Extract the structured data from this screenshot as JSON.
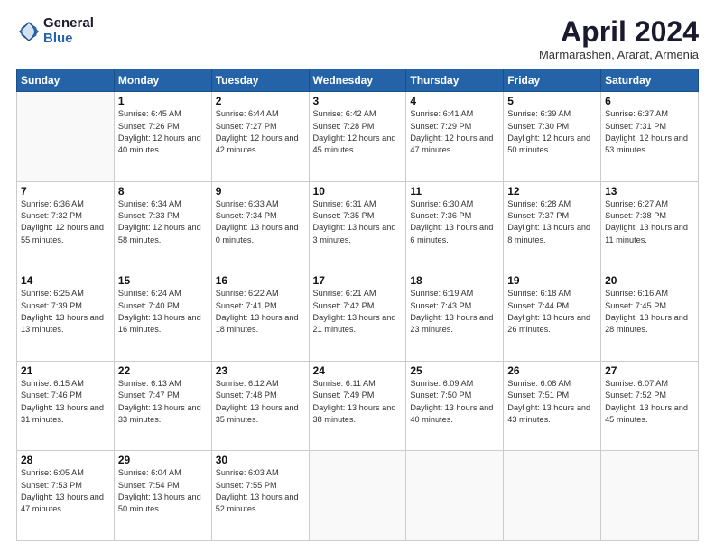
{
  "logo": {
    "general": "General",
    "blue": "Blue"
  },
  "header": {
    "title": "April 2024",
    "subtitle": "Marmarashen, Ararat, Armenia"
  },
  "weekdays": [
    "Sunday",
    "Monday",
    "Tuesday",
    "Wednesday",
    "Thursday",
    "Friday",
    "Saturday"
  ],
  "days": [
    {
      "num": "",
      "sunrise": "",
      "sunset": "",
      "daylight": ""
    },
    {
      "num": "1",
      "sunrise": "Sunrise: 6:45 AM",
      "sunset": "Sunset: 7:26 PM",
      "daylight": "Daylight: 12 hours and 40 minutes."
    },
    {
      "num": "2",
      "sunrise": "Sunrise: 6:44 AM",
      "sunset": "Sunset: 7:27 PM",
      "daylight": "Daylight: 12 hours and 42 minutes."
    },
    {
      "num": "3",
      "sunrise": "Sunrise: 6:42 AM",
      "sunset": "Sunset: 7:28 PM",
      "daylight": "Daylight: 12 hours and 45 minutes."
    },
    {
      "num": "4",
      "sunrise": "Sunrise: 6:41 AM",
      "sunset": "Sunset: 7:29 PM",
      "daylight": "Daylight: 12 hours and 47 minutes."
    },
    {
      "num": "5",
      "sunrise": "Sunrise: 6:39 AM",
      "sunset": "Sunset: 7:30 PM",
      "daylight": "Daylight: 12 hours and 50 minutes."
    },
    {
      "num": "6",
      "sunrise": "Sunrise: 6:37 AM",
      "sunset": "Sunset: 7:31 PM",
      "daylight": "Daylight: 12 hours and 53 minutes."
    },
    {
      "num": "7",
      "sunrise": "Sunrise: 6:36 AM",
      "sunset": "Sunset: 7:32 PM",
      "daylight": "Daylight: 12 hours and 55 minutes."
    },
    {
      "num": "8",
      "sunrise": "Sunrise: 6:34 AM",
      "sunset": "Sunset: 7:33 PM",
      "daylight": "Daylight: 12 hours and 58 minutes."
    },
    {
      "num": "9",
      "sunrise": "Sunrise: 6:33 AM",
      "sunset": "Sunset: 7:34 PM",
      "daylight": "Daylight: 13 hours and 0 minutes."
    },
    {
      "num": "10",
      "sunrise": "Sunrise: 6:31 AM",
      "sunset": "Sunset: 7:35 PM",
      "daylight": "Daylight: 13 hours and 3 minutes."
    },
    {
      "num": "11",
      "sunrise": "Sunrise: 6:30 AM",
      "sunset": "Sunset: 7:36 PM",
      "daylight": "Daylight: 13 hours and 6 minutes."
    },
    {
      "num": "12",
      "sunrise": "Sunrise: 6:28 AM",
      "sunset": "Sunset: 7:37 PM",
      "daylight": "Daylight: 13 hours and 8 minutes."
    },
    {
      "num": "13",
      "sunrise": "Sunrise: 6:27 AM",
      "sunset": "Sunset: 7:38 PM",
      "daylight": "Daylight: 13 hours and 11 minutes."
    },
    {
      "num": "14",
      "sunrise": "Sunrise: 6:25 AM",
      "sunset": "Sunset: 7:39 PM",
      "daylight": "Daylight: 13 hours and 13 minutes."
    },
    {
      "num": "15",
      "sunrise": "Sunrise: 6:24 AM",
      "sunset": "Sunset: 7:40 PM",
      "daylight": "Daylight: 13 hours and 16 minutes."
    },
    {
      "num": "16",
      "sunrise": "Sunrise: 6:22 AM",
      "sunset": "Sunset: 7:41 PM",
      "daylight": "Daylight: 13 hours and 18 minutes."
    },
    {
      "num": "17",
      "sunrise": "Sunrise: 6:21 AM",
      "sunset": "Sunset: 7:42 PM",
      "daylight": "Daylight: 13 hours and 21 minutes."
    },
    {
      "num": "18",
      "sunrise": "Sunrise: 6:19 AM",
      "sunset": "Sunset: 7:43 PM",
      "daylight": "Daylight: 13 hours and 23 minutes."
    },
    {
      "num": "19",
      "sunrise": "Sunrise: 6:18 AM",
      "sunset": "Sunset: 7:44 PM",
      "daylight": "Daylight: 13 hours and 26 minutes."
    },
    {
      "num": "20",
      "sunrise": "Sunrise: 6:16 AM",
      "sunset": "Sunset: 7:45 PM",
      "daylight": "Daylight: 13 hours and 28 minutes."
    },
    {
      "num": "21",
      "sunrise": "Sunrise: 6:15 AM",
      "sunset": "Sunset: 7:46 PM",
      "daylight": "Daylight: 13 hours and 31 minutes."
    },
    {
      "num": "22",
      "sunrise": "Sunrise: 6:13 AM",
      "sunset": "Sunset: 7:47 PM",
      "daylight": "Daylight: 13 hours and 33 minutes."
    },
    {
      "num": "23",
      "sunrise": "Sunrise: 6:12 AM",
      "sunset": "Sunset: 7:48 PM",
      "daylight": "Daylight: 13 hours and 35 minutes."
    },
    {
      "num": "24",
      "sunrise": "Sunrise: 6:11 AM",
      "sunset": "Sunset: 7:49 PM",
      "daylight": "Daylight: 13 hours and 38 minutes."
    },
    {
      "num": "25",
      "sunrise": "Sunrise: 6:09 AM",
      "sunset": "Sunset: 7:50 PM",
      "daylight": "Daylight: 13 hours and 40 minutes."
    },
    {
      "num": "26",
      "sunrise": "Sunrise: 6:08 AM",
      "sunset": "Sunset: 7:51 PM",
      "daylight": "Daylight: 13 hours and 43 minutes."
    },
    {
      "num": "27",
      "sunrise": "Sunrise: 6:07 AM",
      "sunset": "Sunset: 7:52 PM",
      "daylight": "Daylight: 13 hours and 45 minutes."
    },
    {
      "num": "28",
      "sunrise": "Sunrise: 6:05 AM",
      "sunset": "Sunset: 7:53 PM",
      "daylight": "Daylight: 13 hours and 47 minutes."
    },
    {
      "num": "29",
      "sunrise": "Sunrise: 6:04 AM",
      "sunset": "Sunset: 7:54 PM",
      "daylight": "Daylight: 13 hours and 50 minutes."
    },
    {
      "num": "30",
      "sunrise": "Sunrise: 6:03 AM",
      "sunset": "Sunset: 7:55 PM",
      "daylight": "Daylight: 13 hours and 52 minutes."
    }
  ]
}
